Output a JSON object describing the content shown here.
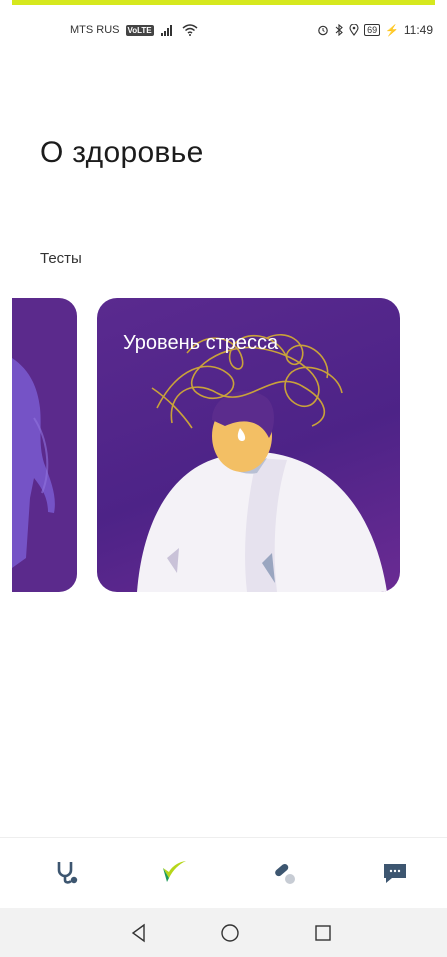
{
  "status_bar": {
    "carrier": "MTS RUS",
    "volte": "VoLTE",
    "battery": "69",
    "time": "11:49"
  },
  "page": {
    "title": "О здоровье",
    "section_label": "Тесты"
  },
  "cards": [
    {
      "title": "Уровень стресса"
    }
  ],
  "bottom_nav": {
    "items": [
      {
        "icon": "stethoscope-icon"
      },
      {
        "icon": "leaf-logo-icon"
      },
      {
        "icon": "pill-icon"
      },
      {
        "icon": "chat-icon"
      }
    ]
  },
  "system_nav": {
    "items": [
      {
        "icon": "back-icon"
      },
      {
        "icon": "home-icon"
      },
      {
        "icon": "recents-icon"
      }
    ]
  },
  "colors": {
    "accent": "#d6e81e",
    "card": "#5a2a8f",
    "nav_icon": "#3d5670"
  }
}
